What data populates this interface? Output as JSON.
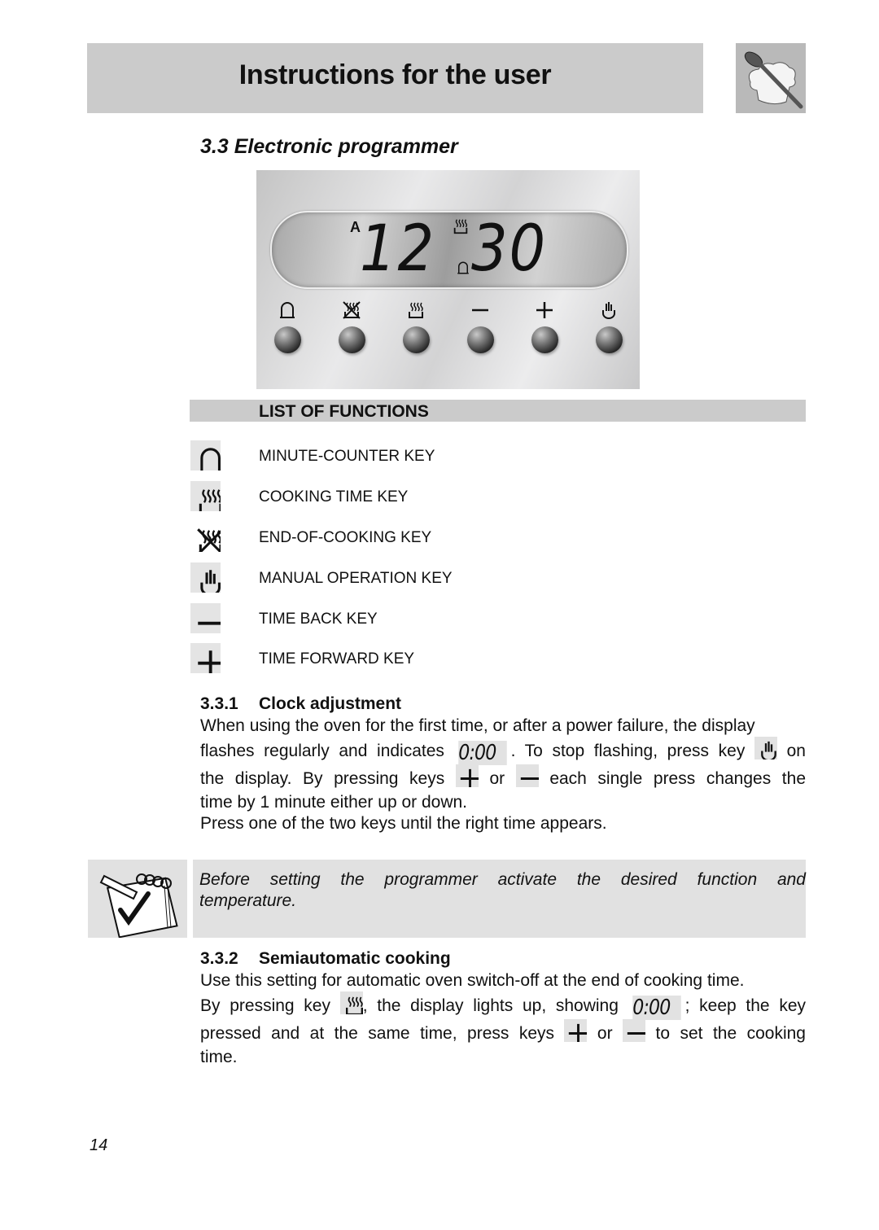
{
  "header": {
    "title": "Instructions for the user",
    "logo_icon": "spoon-chef-hat-icon"
  },
  "section": {
    "title": "3.3 Electronic programmer"
  },
  "panel": {
    "display": {
      "indicator_a": "A",
      "hours": "12",
      "minutes": "30",
      "top_icon": "cooking-time-icon",
      "bottom_icon": "bell-icon"
    },
    "keys": [
      {
        "icon": "bell-icon",
        "name": "minute-counter"
      },
      {
        "icon": "end-of-cooking-icon",
        "name": "end-of-cooking"
      },
      {
        "icon": "cooking-time-icon",
        "name": "cooking-time"
      },
      {
        "icon": "minus-icon",
        "name": "time-back"
      },
      {
        "icon": "plus-icon",
        "name": "time-forward"
      },
      {
        "icon": "hand-icon",
        "name": "manual-operation"
      }
    ]
  },
  "functions": {
    "title": "LIST OF FUNCTIONS",
    "items": [
      {
        "icon": "bell-icon",
        "label": "MINUTE-COUNTER KEY"
      },
      {
        "icon": "cooking-time-icon",
        "label": "COOKING TIME KEY"
      },
      {
        "icon": "end-of-cooking-icon",
        "label": "END-OF-COOKING KEY"
      },
      {
        "icon": "hand-icon",
        "label": "MANUAL OPERATION KEY"
      },
      {
        "icon": "minus-icon",
        "label": "TIME BACK KEY"
      },
      {
        "icon": "plus-icon",
        "label": "TIME FORWARD KEY"
      }
    ]
  },
  "clock": {
    "number": "3.3.1",
    "title": "Clock adjustment",
    "line1": "When using the oven for the first time, or after a power failure, the display",
    "line2a": "flashes regularly and indicates",
    "display_value": "0:00",
    "line2b": ". To stop flashing, press key",
    "line2c": "on",
    "line3a": "the display. By pressing keys",
    "line3b": "or",
    "line3c": "each single press changes the",
    "line4": "time by 1 minute either up or down.",
    "line5": "Press one of the two keys until the right time appears."
  },
  "note": {
    "icon": "notepad-check-icon",
    "text": "Before setting the programmer activate the desired function and temperature."
  },
  "semi": {
    "number": "3.3.2",
    "title": "Semiautomatic cooking",
    "line1": "Use this setting for automatic oven switch-off at the end of cooking time.",
    "line2a": "By pressing key",
    "line2b": ", the display lights up, showing",
    "display_value": "0:00",
    "line2c": "; keep the key",
    "line3a": "pressed and at the same time, press keys",
    "line3b": "or",
    "line3c": "to set the cooking",
    "line4": "time."
  },
  "footer": {
    "page_number": "14"
  }
}
